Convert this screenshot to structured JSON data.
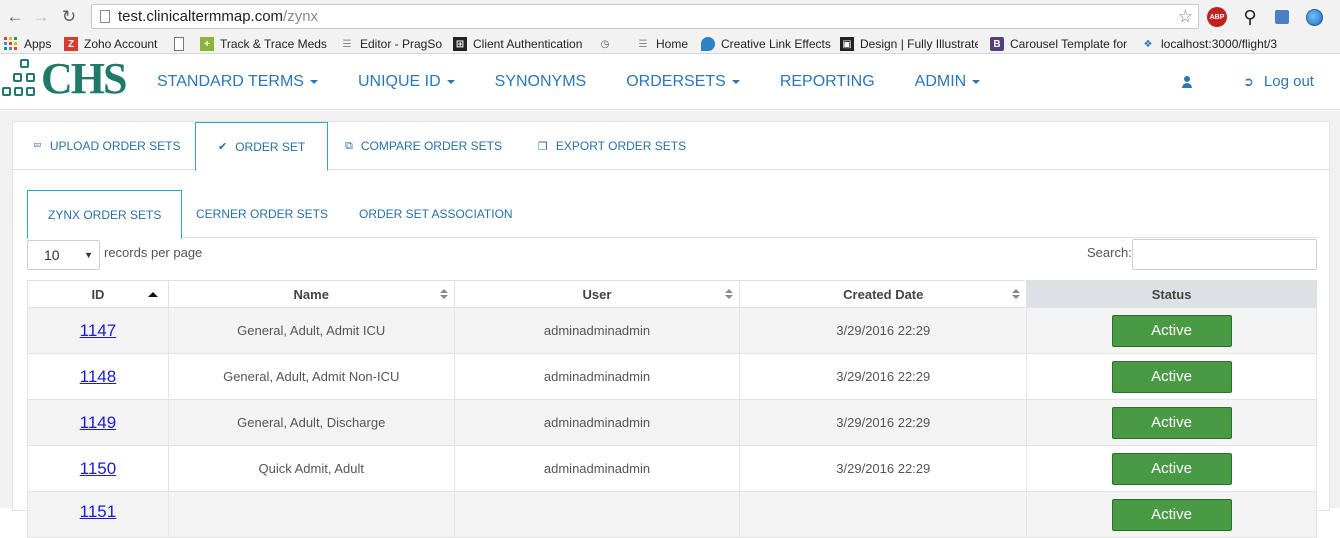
{
  "browser": {
    "url_host": "test.clinicaltermmap.com",
    "url_path": "/zynx",
    "abp_label": "ABP",
    "bookmarks": [
      {
        "label": "Apps"
      },
      {
        "label": "Zoho Account",
        "icon": "Z"
      },
      {
        "label": ""
      },
      {
        "label": "Track & Trace Meds"
      },
      {
        "label": "Editor - PragSo"
      },
      {
        "label": "Client Authentication"
      },
      {
        "label": ""
      },
      {
        "label": "Home"
      },
      {
        "label": "Creative Link Effects"
      },
      {
        "label": "Design | Fully Illustrate"
      },
      {
        "label": "Carousel Template for",
        "icon": "B"
      },
      {
        "label": "localhost:3000/flight/3"
      }
    ]
  },
  "app": {
    "logo_text": "CHS",
    "nav": [
      {
        "label": "STANDARD TERMS",
        "dropdown": true
      },
      {
        "label": "UNIQUE ID",
        "dropdown": true
      },
      {
        "label": "SYNONYMS",
        "dropdown": false
      },
      {
        "label": "ORDERSETS",
        "dropdown": true
      },
      {
        "label": "REPORTING",
        "dropdown": false
      },
      {
        "label": "ADMIN",
        "dropdown": true
      }
    ],
    "logout_label": "Log out"
  },
  "top_tabs": [
    {
      "label": "UPLOAD ORDER SETS",
      "icon": "upload-icon"
    },
    {
      "label": "ORDER SET",
      "icon": "check-icon",
      "active": true
    },
    {
      "label": "COMPARE ORDER SETS",
      "icon": "copy-icon"
    },
    {
      "label": "EXPORT ORDER SETS",
      "icon": "export-icon"
    }
  ],
  "sub_tabs": [
    {
      "label": "ZYNX ORDER SETS",
      "active": true
    },
    {
      "label": "CERNER ORDER SETS"
    },
    {
      "label": "ORDER SET ASSOCIATION"
    }
  ],
  "table_controls": {
    "page_length": "10",
    "length_label": "records per page",
    "search_label": "Search:",
    "search_value": ""
  },
  "table": {
    "columns": [
      "ID",
      "Name",
      "User",
      "Created Date",
      "Status"
    ],
    "rows": [
      {
        "id": "1147",
        "name": "General, Adult, Admit ICU",
        "user": "adminadminadmin",
        "created": "3/29/2016 22:29",
        "status": "Active"
      },
      {
        "id": "1148",
        "name": "General, Adult, Admit Non-ICU",
        "user": "adminadminadmin",
        "created": "3/29/2016 22:29",
        "status": "Active"
      },
      {
        "id": "1149",
        "name": "General, Adult, Discharge",
        "user": "adminadminadmin",
        "created": "3/29/2016 22:29",
        "status": "Active"
      },
      {
        "id": "1150",
        "name": "Quick Admit, Adult",
        "user": "adminadminadmin",
        "created": "3/29/2016 22:29",
        "status": "Active"
      },
      {
        "id": "1151",
        "name": "",
        "user": "",
        "created": "",
        "status": "Active"
      }
    ]
  },
  "colors": {
    "brand": "#1f7a6a",
    "link": "#2a77b8",
    "active_green": "#4a9a45",
    "tab_border": "#2aa8c4"
  }
}
